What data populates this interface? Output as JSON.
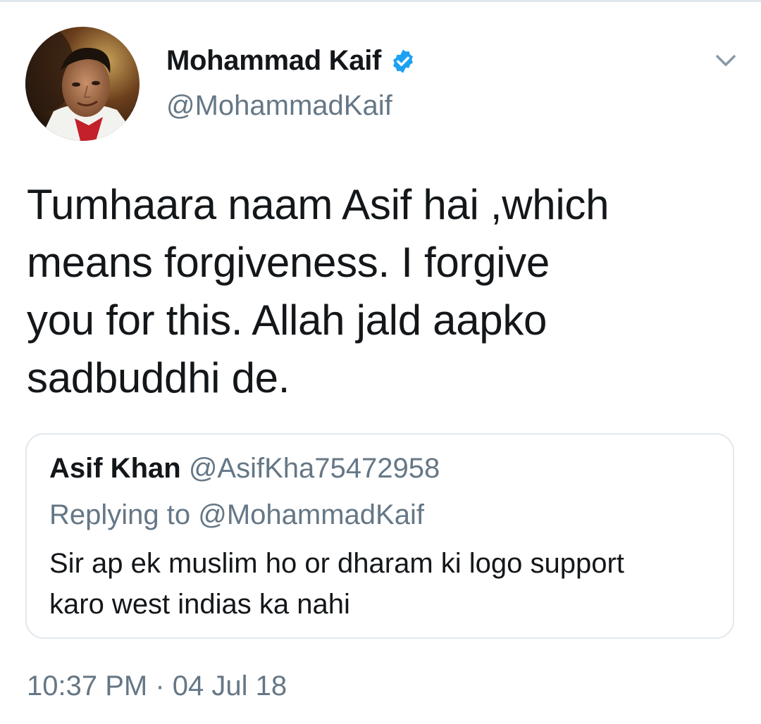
{
  "author": {
    "display_name": "Mohammad Kaif",
    "handle": "@MohammadKaif",
    "verified_icon": "verified-badge-icon",
    "accent_color": "#1da1f2"
  },
  "menu": {
    "icon": "chevron-down-icon"
  },
  "tweet": {
    "lines": [
      "Tumhaara naam Asif hai ,which",
      "means forgiveness. I forgive",
      "you for this. Allah jald aapko",
      "sadbuddhi de."
    ]
  },
  "quoted": {
    "display_name": "Asif Khan",
    "handle": "@AsifKha75472958",
    "replying_to": "Replying to @MohammadKaif",
    "lines": [
      "Sir ap ek muslim ho or dharam ki logo support",
      "karo west indias ka nahi"
    ]
  },
  "meta": {
    "time": "10:37 PM",
    "separator": "·",
    "date": "04 Jul 18"
  }
}
